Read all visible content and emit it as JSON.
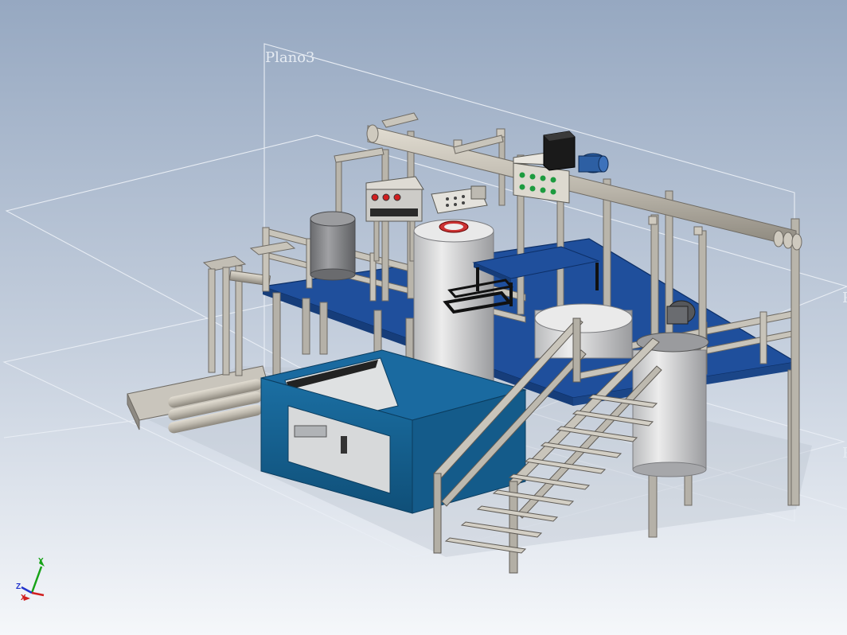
{
  "viewport": {
    "background_top": "#97a9c2",
    "background_bottom": "#f4f6f9"
  },
  "planes": {
    "plano3_label": "Plano3",
    "right_label_1": "P",
    "right_label_2": "P"
  },
  "triad": {
    "x_label": "X",
    "y_label": "Y",
    "z_label": "Z",
    "x_color": "#d01f1f",
    "y_color": "#17a317",
    "z_color": "#2233cc"
  },
  "colors": {
    "platform_blue": "#1f4f9c",
    "frame_grey": "#a5a19a",
    "tank_light": "#d9dadb",
    "tank_dark": "#7a7b7f",
    "cabinet_teal": "#14608f",
    "motor_black": "#1a1a1a"
  }
}
